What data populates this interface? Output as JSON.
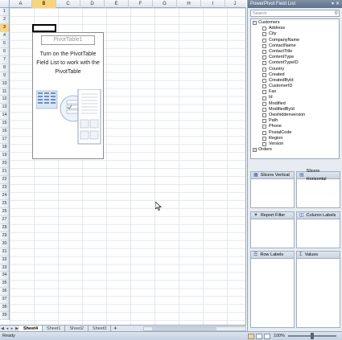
{
  "columns": [
    "A",
    "B",
    "C",
    "D",
    "E",
    "F",
    "G",
    "H",
    "I",
    "J"
  ],
  "active_column": "B",
  "rows": [
    "1",
    "2",
    "3",
    "4",
    "5",
    "6",
    "7",
    "8",
    "9",
    "10",
    "11",
    "12",
    "13",
    "14",
    "15",
    "16",
    "17",
    "18",
    "19",
    "20",
    "21",
    "22",
    "23",
    "24",
    "25",
    "26",
    "27",
    "28",
    "29",
    "30",
    "31",
    "32",
    "33",
    "34",
    "35",
    "36",
    "37",
    "38",
    "39"
  ],
  "active_row": "3",
  "pivot": {
    "name": "PivotTable1",
    "message": "Turn on the PivotTable Field List to work with the PivotTable"
  },
  "sheet_tabs": [
    "Sheet4",
    "Sheet1",
    "Sheet2",
    "Sheet3"
  ],
  "active_tab": "Sheet4",
  "status": {
    "text": "Ready",
    "zoom": "100%"
  },
  "panel": {
    "title": "PowerPivot Field List",
    "search_placeholder": "Search",
    "tables": [
      {
        "name": "Customers",
        "expanded": true,
        "fields": [
          "Address",
          "City",
          "CompanyName",
          "ContactName",
          "ContactTitle",
          "ContentType",
          "ContentTypeID",
          "Country",
          "Created",
          "CreatedById",
          "CustomerID",
          "Fax",
          "Id",
          "Modified",
          "ModifiedById",
          "Owshiddenversion",
          "Path",
          "Phone",
          "PostalCode",
          "Region",
          "Version"
        ]
      },
      {
        "name": "Orders",
        "expanded": false,
        "fields": []
      }
    ],
    "zones": {
      "slicers_vertical": "Slicers Vertical",
      "slicers_horizontal": "Slicers Horizontal",
      "report_filter": "Report Filter",
      "column_labels": "Column Labels",
      "row_labels": "Row Labels",
      "values": "Values"
    }
  }
}
